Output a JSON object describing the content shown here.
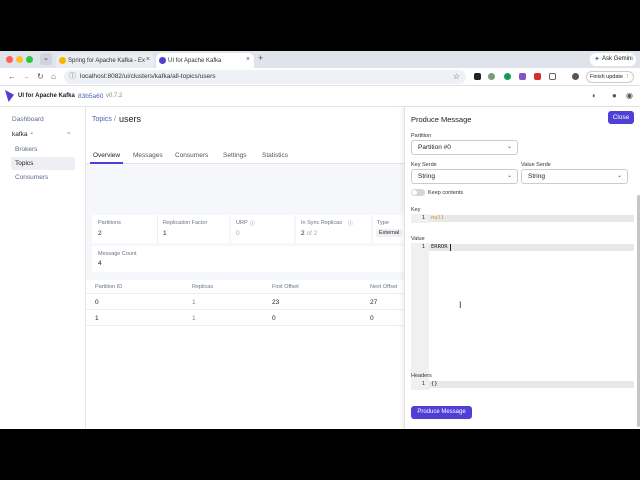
{
  "browser": {
    "tabs": [
      {
        "label": "Spring for Apache Kafka - Ex"
      },
      {
        "label": "UI for Apache Kafka"
      }
    ],
    "new_tab": "+",
    "ask_gemini": "Ask Gemini",
    "url": "localhost:8082/ui/clusters/kafka/all-topics/users",
    "finish_update": "Finish update"
  },
  "app": {
    "logo": "UI for Apache Kafka",
    "version_hash": "83b5a60",
    "version": "v0.7.2"
  },
  "sidebar": {
    "dashboard": "Dashboard",
    "cluster": "kafka",
    "items": [
      "Brokers",
      "Topics",
      "Consumers"
    ]
  },
  "topic": {
    "breadcrumb_root": "Topics",
    "separator": "/",
    "name": "users",
    "tabs": [
      "Overview",
      "Messages",
      "Consumers",
      "Settings",
      "Statistics"
    ],
    "stats": {
      "partitions_label": "Partitions",
      "partitions_value": "2",
      "rf_label": "Replication Factor",
      "rf_value": "1",
      "urp_label": "URP",
      "urp_value": "0",
      "isr_label": "In Sync Replicas",
      "isr_value": "2",
      "isr_of": "of 2",
      "type_label": "Type",
      "type_value": "External",
      "msg_count_label": "Message Count",
      "msg_count_value": "4"
    },
    "table": {
      "headers": [
        "Partition ID",
        "Replicas",
        "First Offset",
        "Next Offset"
      ],
      "rows": [
        [
          "0",
          "1",
          "23",
          "27"
        ],
        [
          "1",
          "1",
          "0",
          "0"
        ]
      ]
    }
  },
  "produce": {
    "title": "Produce Message",
    "close": "Close",
    "partition_label": "Partition",
    "partition_value": "Partition #0",
    "key_serde_label": "Key Serde",
    "key_serde_value": "String",
    "value_serde_label": "Value Serde",
    "value_serde_value": "String",
    "keep_contents": "Keep contents",
    "key_label": "Key",
    "key_line": "1",
    "key_code": "null",
    "value_label": "Value",
    "value_line": "1",
    "value_code": "ERROR",
    "headers_label": "Headers",
    "headers_line": "1",
    "headers_code": "{}",
    "submit": "Produce Message"
  },
  "colors": {
    "accent": "#4f3fd6",
    "key_code": "#e08a1e",
    "link": "#4a5fb5"
  }
}
